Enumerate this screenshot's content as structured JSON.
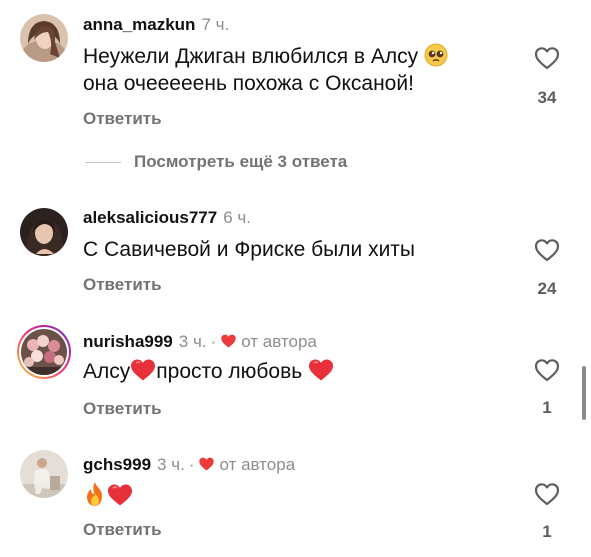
{
  "comments": [
    {
      "username": "anna_mazkun",
      "time": "7 ч.",
      "text_line1": "Неужели Джиган влюбился в Алсу",
      "text_line2": "она очееееень похожа с Оксаной!",
      "reply_label": "Ответить",
      "likes": "34",
      "avatar_icon": "woman-portrait-avatar"
    },
    {
      "username": "aleksalicious777",
      "time": "6 ч.",
      "text_line1": "С Савичевой и Фриске были хиты",
      "reply_label": "Ответить",
      "likes": "24",
      "avatar_icon": "woman-portrait-avatar"
    },
    {
      "username": "nurisha999",
      "time": "3 ч.",
      "dot": "·",
      "author_label": "от автора",
      "text_before": "Алсу",
      "text_after": "просто любовь",
      "reply_label": "Ответить",
      "likes": "1",
      "avatar_icon": "flowers-avatar"
    },
    {
      "username": "gchs999",
      "time": "3 ч.",
      "dot": "·",
      "author_label": "от автора",
      "reply_label": "Ответить",
      "likes": "1",
      "avatar_icon": "person-seated-avatar"
    }
  ],
  "view_replies": "Посмотреть ещё 3 ответа",
  "colors": {
    "text": "#111111",
    "secondary": "#8e8e8e",
    "reply": "#737373",
    "heart_red": "#ed3b3b"
  },
  "icons": {
    "like": "heart-outline-icon",
    "author_like": "red-heart-icon",
    "emoji_pleading": "pleading-face-emoji",
    "emoji_heart": "red-heart-emoji",
    "emoji_fire": "fire-emoji"
  }
}
